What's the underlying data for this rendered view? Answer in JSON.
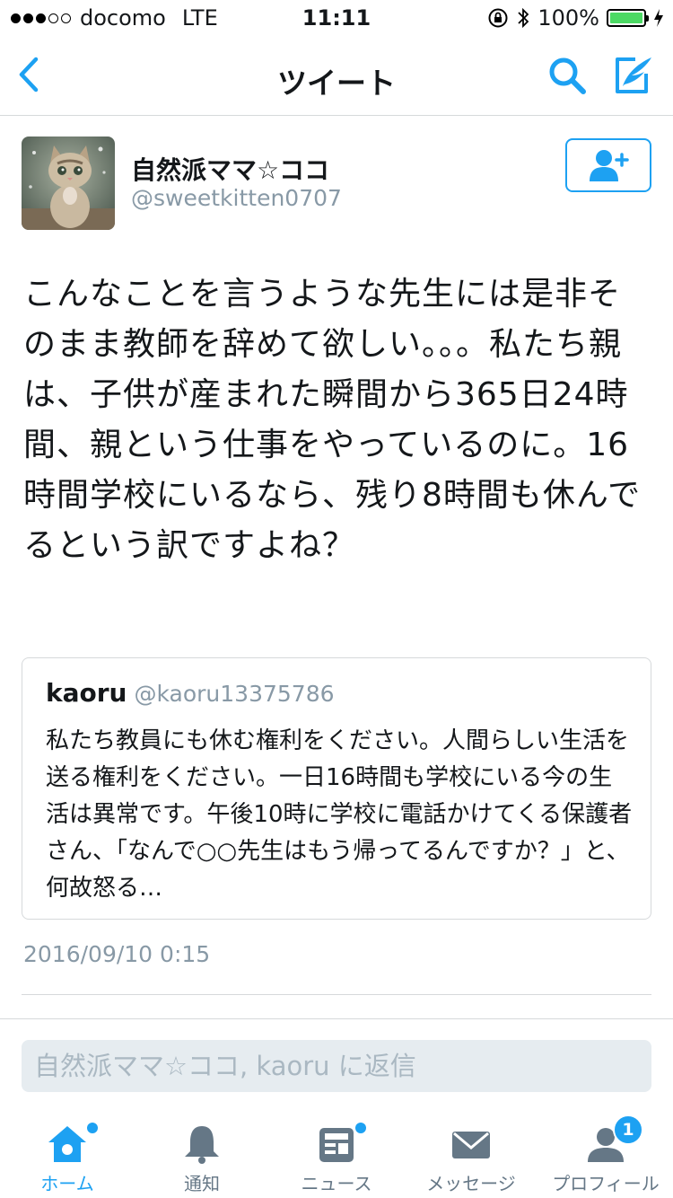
{
  "status_bar": {
    "carrier": "docomo",
    "network": "LTE",
    "time": "11:11",
    "battery": "100%",
    "signal_bars": 3,
    "battery_level": 1.0
  },
  "nav": {
    "title": "ツイート",
    "back_icon": "chevron-left-icon",
    "search_icon": "search-icon",
    "compose_icon": "compose-tweet-icon"
  },
  "tweet": {
    "display_name": "自然派ママ☆ココ",
    "handle": "@sweetkitten0707",
    "text": "こんなことを言うような先生には是非そのまま教師を辞めて欲しい。。。私たち親は、子供が産まれた瞬間から365日24時間、親という仕事をやっているのに。16時間学校にいるなら、残り8時間も休んでるという訳ですよね？",
    "timestamp": "2016/09/10 0:15"
  },
  "quoted_tweet": {
    "name": "kaoru",
    "handle": "@kaoru13375786",
    "text": "私たち教員にも休む権利をください。人間らしい生活を送る権利をください。一日16時間も学校にいる今の生活は異常です。午後10時に学校に電話かけてくる保護者さん、「なんで○○先生はもう帰ってるんですか？」と、何故怒る…"
  },
  "reply": {
    "placeholder": "自然派ママ☆ココ, kaoru に返信"
  },
  "tabs": [
    {
      "label": "ホーム",
      "icon": "home-icon",
      "active": true,
      "dot": true
    },
    {
      "label": "通知",
      "icon": "bell-icon",
      "active": false,
      "dot": false
    },
    {
      "label": "ニュース",
      "icon": "news-icon",
      "active": false,
      "dot": true
    },
    {
      "label": "メッセージ",
      "icon": "envelope-icon",
      "active": false,
      "dot": false
    },
    {
      "label": "プロフィール",
      "icon": "profile-icon",
      "active": false,
      "badge": "1"
    }
  ],
  "colors": {
    "accent": "#1da1f2",
    "text": "#14171a",
    "muted": "#8899a6",
    "battery_green": "#4cd964"
  }
}
